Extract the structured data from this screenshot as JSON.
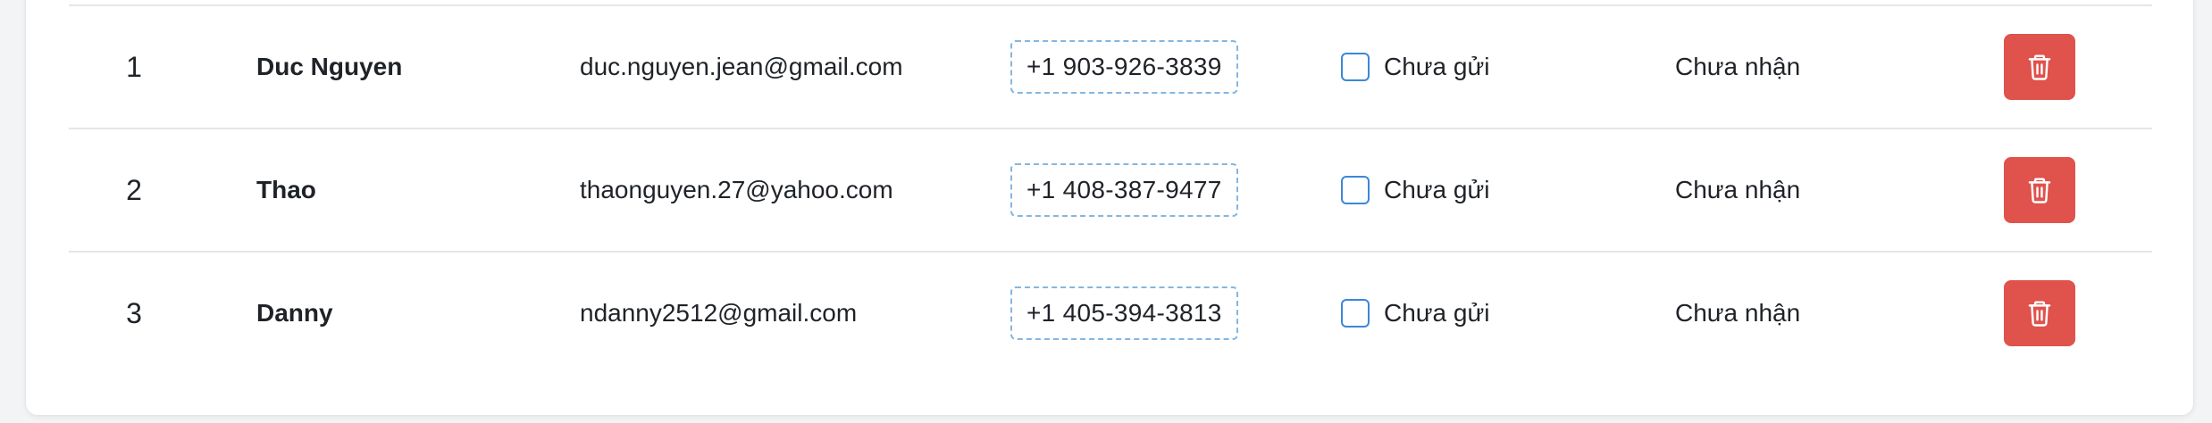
{
  "colors": {
    "delete_button": "#e0524c",
    "checkbox_border": "#3b87d8",
    "phone_border": "#84b6e0"
  },
  "icons": {
    "delete": "trash-icon"
  },
  "rows": [
    {
      "index": "1",
      "name": "Duc Nguyen",
      "email": "duc.nguyen.jean@gmail.com",
      "phone": "+1 903-926-3839",
      "send_status": "Chưa gửi",
      "receive_status": "Chưa nhận"
    },
    {
      "index": "2",
      "name": "Thao",
      "email": "thaonguyen.27@yahoo.com",
      "phone": "+1 408-387-9477",
      "send_status": "Chưa gửi",
      "receive_status": "Chưa nhận"
    },
    {
      "index": "3",
      "name": "Danny",
      "email": "ndanny2512@gmail.com",
      "phone": "+1 405-394-3813",
      "send_status": "Chưa gửi",
      "receive_status": "Chưa nhận"
    }
  ]
}
